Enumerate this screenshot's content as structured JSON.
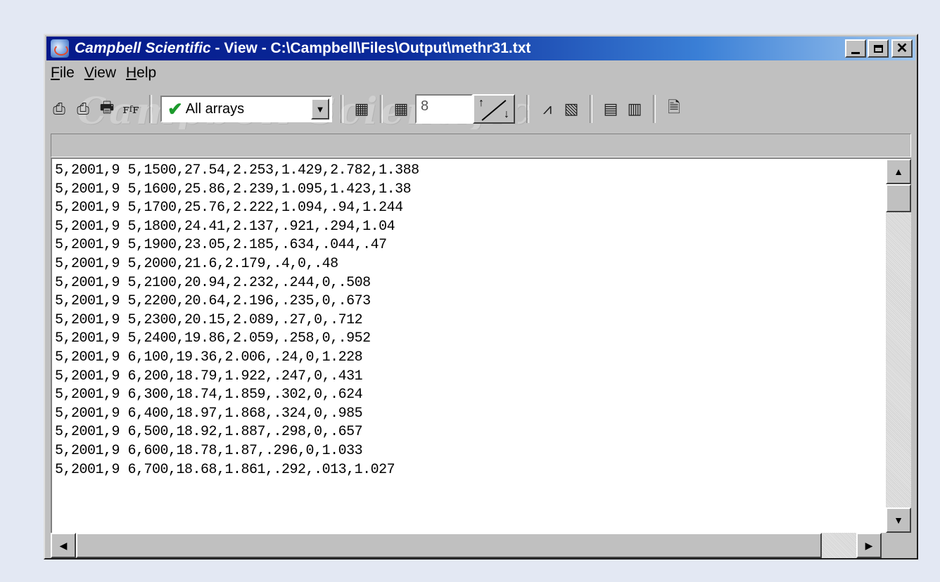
{
  "window": {
    "title_brand": "Campbell Scientific",
    "title_rest": " - View -  C:\\Campbell\\Files\\Output\\methr31.txt"
  },
  "menu": {
    "file": "File",
    "view": "View",
    "help": "Help"
  },
  "toolbar": {
    "array_filter": "All arrays",
    "columns_value": "8",
    "watermark": "Campbell Scientific"
  },
  "lines": [
    "5,2001,9 5,1500,27.54,2.253,1.429,2.782,1.388",
    "5,2001,9 5,1600,25.86,2.239,1.095,1.423,1.38",
    "5,2001,9 5,1700,25.76,2.222,1.094,.94,1.244",
    "5,2001,9 5,1800,24.41,2.137,.921,.294,1.04",
    "5,2001,9 5,1900,23.05,2.185,.634,.044,.47",
    "5,2001,9 5,2000,21.6,2.179,.4,0,.48",
    "5,2001,9 5,2100,20.94,2.232,.244,0,.508",
    "5,2001,9 5,2200,20.64,2.196,.235,0,.673",
    "5,2001,9 5,2300,20.15,2.089,.27,0,.712",
    "5,2001,9 5,2400,19.86,2.059,.258,0,.952",
    "5,2001,9 6,100,19.36,2.006,.24,0,1.228",
    "5,2001,9 6,200,18.79,1.922,.247,0,.431",
    "5,2001,9 6,300,18.74,1.859,.302,0,.624",
    "5,2001,9 6,400,18.97,1.868,.324,0,.985",
    "5,2001,9 6,500,18.92,1.887,.298,0,.657",
    "5,2001,9 6,600,18.78,1.87,.296,0,1.033",
    "5,2001,9 6,700,18.68,1.861,.292,.013,1.027"
  ]
}
